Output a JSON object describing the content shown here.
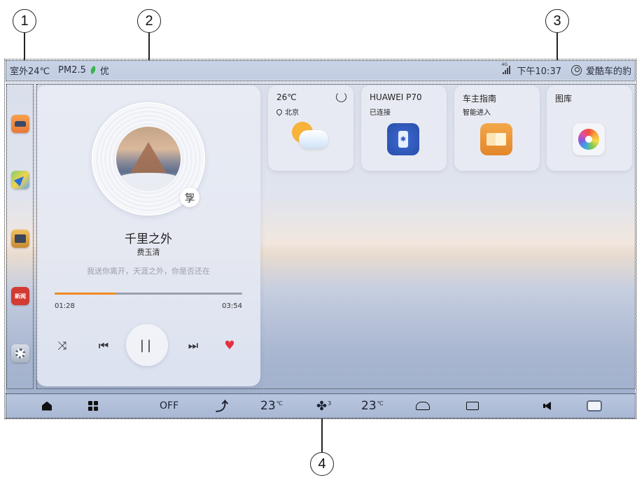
{
  "callouts": [
    "1",
    "2",
    "3",
    "4"
  ],
  "status_bar": {
    "outdoor_temp": "室外24℃",
    "pm25_label": "PM2.5",
    "air_quality": "优",
    "network": "4G",
    "time": "下午10:37",
    "username": "爱酷车的豹"
  },
  "dock": {
    "apps": [
      {
        "icon": "car-icon"
      },
      {
        "icon": "navigation-icon"
      },
      {
        "icon": "media-icon"
      },
      {
        "icon": "news-icon",
        "label": "新闻"
      },
      {
        "icon": "settings-icon"
      }
    ]
  },
  "music": {
    "title": "千里之外",
    "artist": "费玉清",
    "lyric": "我送你离开，天涯之外，你是否还在",
    "lyric_button": "㝁",
    "elapsed": "01:28",
    "total": "03:54",
    "progress": 0.33,
    "progress_color": "#f08a24",
    "controls": {
      "shuffle": "⤨",
      "prev": "⏮",
      "play_pause": "||",
      "next": "⏭",
      "like": "♥"
    }
  },
  "widgets": {
    "weather": {
      "temp": "26℃",
      "city": "北京"
    },
    "phone": {
      "name": "HUAWEI P70",
      "status": "已连接",
      "bt_symbol": "✱"
    },
    "guide": {
      "title": "车主指南",
      "subtitle": "智能进入"
    },
    "gallery": {
      "title": "图库"
    }
  },
  "control_bar": {
    "ac_status": "OFF",
    "fan_icon": "✤",
    "airflow_icon": "⤴",
    "temp_left": "23",
    "temp_right": "23",
    "temp_unit": "℃",
    "fan_level": "3",
    "accent_color": "#b9c6de"
  }
}
